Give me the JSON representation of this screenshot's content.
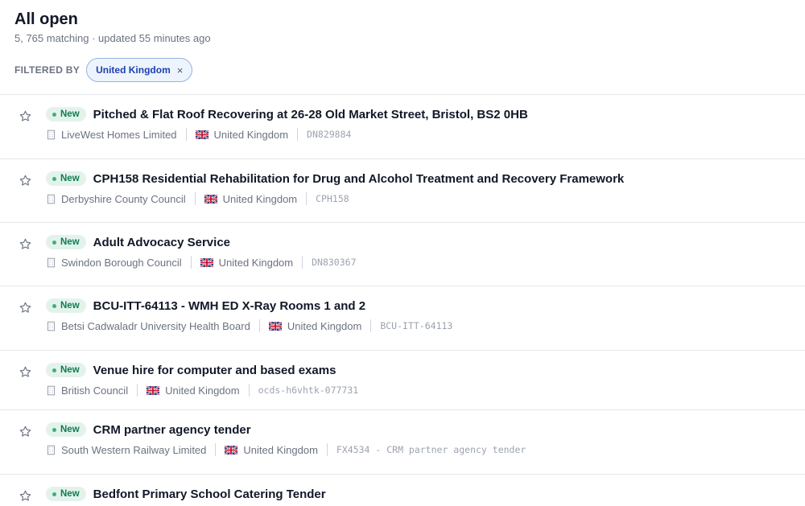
{
  "header": {
    "title": "All open",
    "subtitle": "5, 765 matching · updated 55 minutes ago"
  },
  "filter": {
    "label": "FILTERED BY",
    "chip_label": "United Kingdom",
    "chip_close": "×"
  },
  "items": [
    {
      "badge": "New",
      "title": "Pitched & Flat Roof Recovering at 26-28 Old Market Street, Bristol, BS2 0HB",
      "buyer": "LiveWest Homes Limited",
      "country": "United Kingdom",
      "ref": "DN829884"
    },
    {
      "badge": "New",
      "title": "CPH158 Residential Rehabilitation for Drug and Alcohol Treatment and Recovery Framework",
      "buyer": "Derbyshire County Council",
      "country": "United Kingdom",
      "ref": "CPH158"
    },
    {
      "badge": "New",
      "title": "Adult Advocacy Service",
      "buyer": "Swindon Borough Council",
      "country": "United Kingdom",
      "ref": "DN830367"
    },
    {
      "badge": "New",
      "title": "BCU-ITT-64113 - WMH ED X-Ray Rooms 1 and 2",
      "buyer": "Betsi Cadwaladr University Health Board",
      "country": "United Kingdom",
      "ref": "BCU-ITT-64113"
    },
    {
      "badge": "New",
      "title": "Venue hire for computer and based exams",
      "buyer": "British Council",
      "country": "United Kingdom",
      "ref": "ocds-h6vhtk-077731"
    },
    {
      "badge": "New",
      "title": "CRM partner agency tender",
      "buyer": "South Western Railway Limited",
      "country": "United Kingdom",
      "ref": "FX4534 - CRM partner agency tender"
    },
    {
      "badge": "New",
      "title": "Bedfont Primary School Catering Tender",
      "buyer": "",
      "country": "",
      "ref": ""
    }
  ],
  "icons": {
    "star": "star-outline-icon",
    "building": "building-icon",
    "flag": "uk-flag-icon",
    "close": "close-icon"
  },
  "colors": {
    "badge_bg": "#e3f3ec",
    "badge_text": "#0f7b53",
    "chip_border": "#93b4e3",
    "chip_bg": "#eef4fd",
    "chip_text": "#1e40af"
  }
}
